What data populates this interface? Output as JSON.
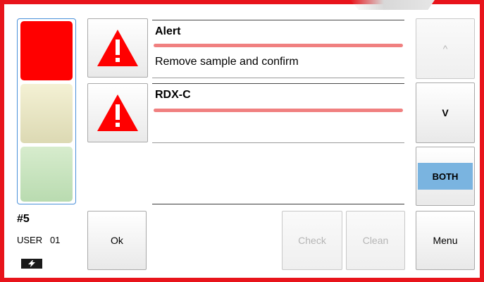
{
  "status_lights": {
    "red": "#ff0000",
    "yellow": "#e9e6c4",
    "green": "#c8e4bf"
  },
  "status": {
    "number": "#5",
    "user": "USER   01",
    "battery_icon": "battery-charging-icon"
  },
  "alerts": [
    {
      "title": "Alert",
      "message": "Remove sample and confirm",
      "icon": "warning-triangle-icon",
      "bar_color": "#f08080"
    },
    {
      "title": "RDX-C",
      "message": "",
      "icon": "warning-triangle-icon",
      "bar_color": "#f08080"
    }
  ],
  "nav": {
    "up_label": "^",
    "down_label": "V",
    "both_label": "BOTH",
    "menu_label": "Menu"
  },
  "actions": {
    "ok_label": "Ok",
    "check_label": "Check",
    "clean_label": "Clean"
  },
  "colors": {
    "frame": "#e8141b",
    "selected": "#7ab4e0",
    "alert_icon": "#ff0000"
  }
}
